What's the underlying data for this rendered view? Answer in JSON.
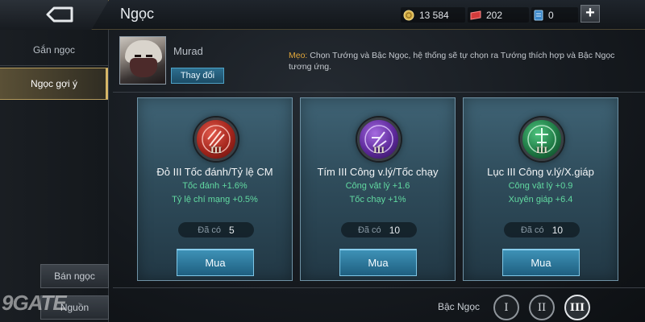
{
  "header": {
    "title": "Ngọc",
    "resources": {
      "gold": "13 584",
      "gems": "202",
      "tickets": "0",
      "add_label": "+"
    }
  },
  "sidebar": {
    "tabs": [
      {
        "label": "Gắn ngọc",
        "active": false
      },
      {
        "label": "Ngọc gợi ý",
        "active": true
      }
    ],
    "buttons": [
      {
        "label": "Bán ngọc"
      },
      {
        "label": "Nguồn"
      }
    ]
  },
  "hero": {
    "name": "Murad",
    "change_label": "Thay đổi",
    "tip_label": "Mẹo:",
    "tip_text": "Chọn Tướng và Bậc Ngọc, hệ thống sẽ tự chọn ra Tướng thích hợp và Bậc Ngọc tương ứng."
  },
  "cards": [
    {
      "color": "#c0392b",
      "icon": "red-gem-icon",
      "tier": "III",
      "title": "Đỏ III Tốc đánh/Tỷ lệ CM",
      "stats": [
        "Tốc đánh +1.6%",
        "Tỷ lệ chí mạng +0.5%"
      ],
      "owned_label": "Đã có",
      "owned_value": "5",
      "buy_label": "Mua"
    },
    {
      "color": "#7d3bbf",
      "icon": "purple-gem-icon",
      "tier": "III",
      "title": "Tím III Công v.lý/Tốc chạy",
      "stats": [
        "Công vật lý +1.6",
        "Tốc chạy +1%"
      ],
      "owned_label": "Đã có",
      "owned_value": "10",
      "buy_label": "Mua"
    },
    {
      "color": "#2e8b57",
      "icon": "green-gem-icon",
      "tier": "III",
      "title": "Lục III Công v.lý/X.giáp",
      "stats": [
        "Công vật lý +0.9",
        "Xuyên giáp +6.4"
      ],
      "owned_label": "Đã có",
      "owned_value": "10",
      "buy_label": "Mua"
    }
  ],
  "tier_selector": {
    "label": "Bậc Ngọc",
    "options": [
      "I",
      "II",
      "III"
    ],
    "selected": "III"
  },
  "watermark": "9GATE"
}
